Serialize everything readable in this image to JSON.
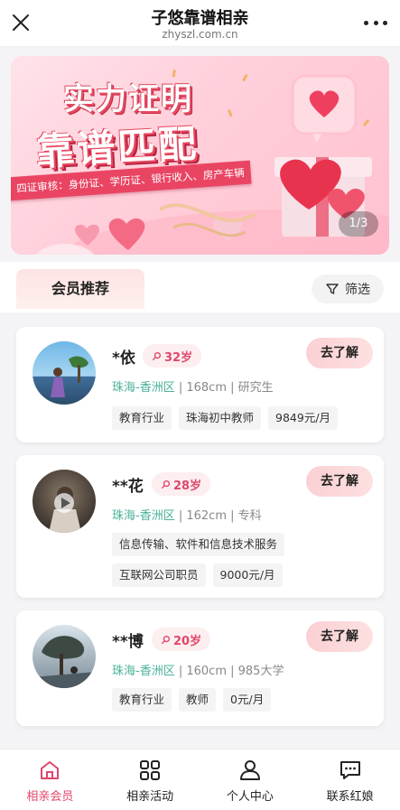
{
  "header": {
    "title": "子悠靠谱相亲",
    "subtitle": "zhyszl.com.cn"
  },
  "banner": {
    "headline_1": "实力证明",
    "headline_2": "靠谱匹配",
    "ribbon": "四证审核：身份证、学历证、银行收入、房产车辆",
    "pager": "1/3"
  },
  "section": {
    "tab_label": "会员推荐",
    "filter_label": "筛选"
  },
  "colors": {
    "accent": "#e0476a",
    "location": "#4bb19b"
  },
  "members": [
    {
      "name": "*依",
      "age": "32岁",
      "location": "珠海-香洲区",
      "height": "168cm",
      "education": "研究生",
      "tags": [
        "教育行业",
        "珠海初中教师",
        "9849元/月"
      ],
      "action": "去了解"
    },
    {
      "name": "**花",
      "age": "28岁",
      "location": "珠海-香洲区",
      "height": "162cm",
      "education": "专科",
      "tags": [
        "信息传输、软件和信息技术服务",
        "互联网公司职员",
        "9000元/月"
      ],
      "action": "去了解"
    },
    {
      "name": "**博",
      "age": "20岁",
      "location": "珠海-香洲区",
      "height": "160cm",
      "education": "985大学",
      "tags": [
        "教育行业",
        "教师",
        "0元/月"
      ],
      "action": "去了解"
    }
  ],
  "nav": [
    {
      "label": "相亲会员",
      "icon": "home-icon",
      "active": true
    },
    {
      "label": "相亲活动",
      "icon": "grid-icon",
      "active": false
    },
    {
      "label": "个人中心",
      "icon": "person-icon",
      "active": false
    },
    {
      "label": "联系红娘",
      "icon": "chat-icon",
      "active": false
    }
  ]
}
